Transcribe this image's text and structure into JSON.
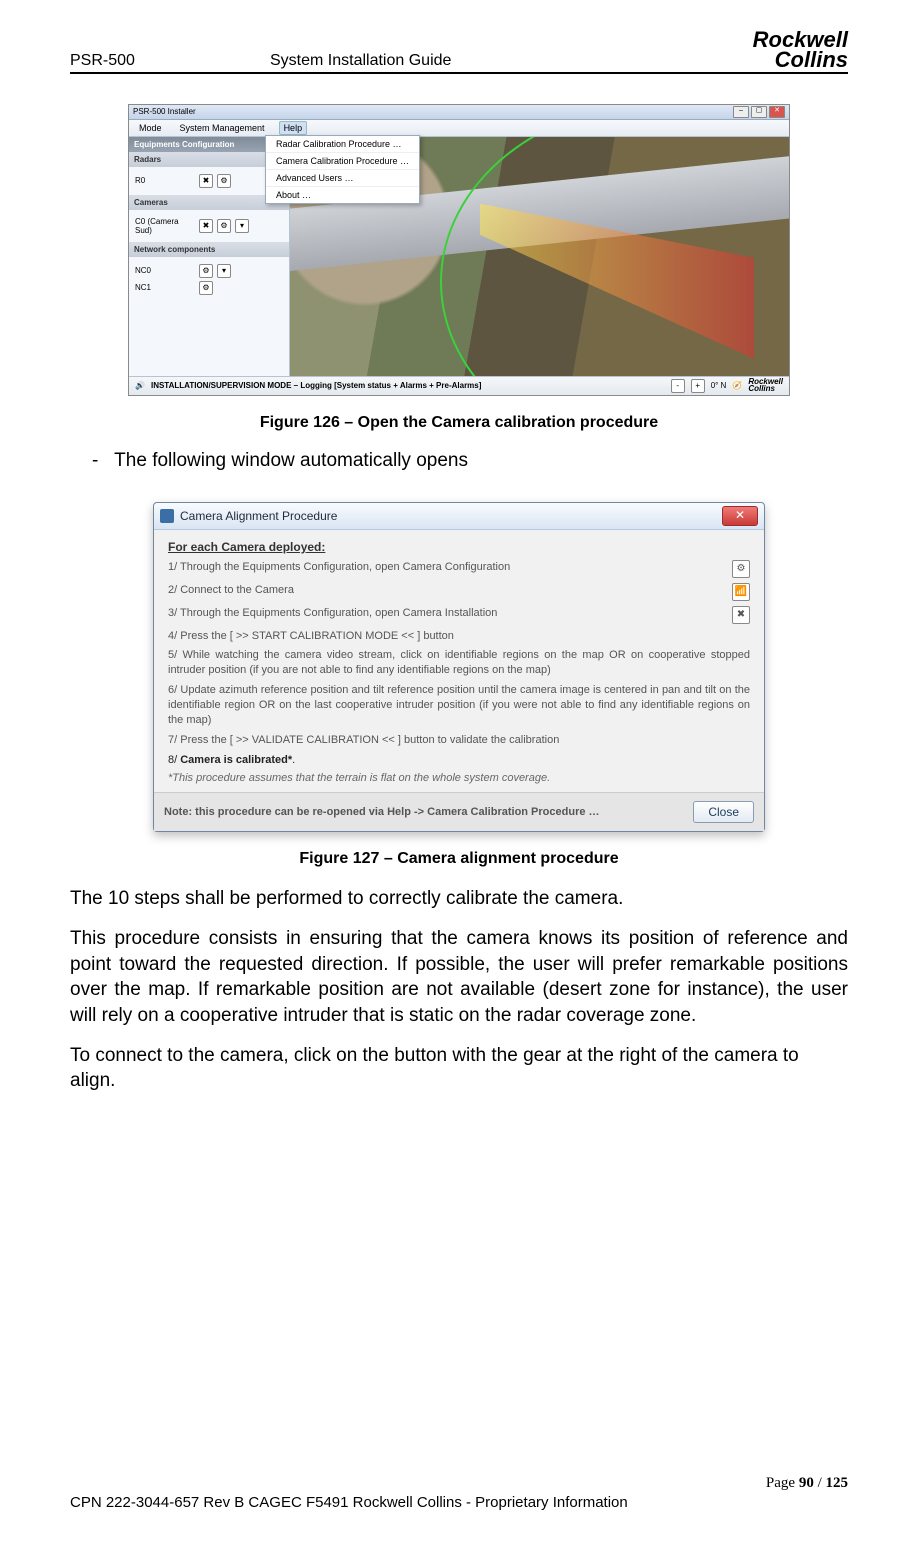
{
  "header": {
    "left": "PSR-500",
    "mid": "System Installation Guide",
    "logo_top": "Rockwell",
    "logo_bot": "Collins"
  },
  "fig126": {
    "caption": "Figure 126 – Open the Camera calibration procedure",
    "win_title": "PSR-500 Installer",
    "menu": {
      "mode": "Mode",
      "sys": "System Management",
      "help": "Help"
    },
    "dropdown": [
      "Radar Calibration Procedure …",
      "Camera Calibration Procedure …",
      "Advanced Users …",
      "About …"
    ],
    "side": {
      "equip": "Equipments Configuration",
      "radars": "Radars",
      "r0": "R0",
      "cameras": "Cameras",
      "c0": "C0 (Camera Sud)",
      "net": "Network components",
      "nc0": "NC0",
      "nc1": "NC1"
    },
    "status": {
      "left": "INSTALLATION/SUPERVISION MODE – Logging [System status + Alarms + Pre-Alarms]",
      "deg": "0° N"
    }
  },
  "bullet": "The following window automatically opens",
  "fig127": {
    "caption": "Figure 127 – Camera alignment procedure",
    "title": "Camera Alignment Procedure",
    "heading": "For each Camera deployed:",
    "steps": [
      "1/ Through the Equipments Configuration, open Camera Configuration",
      "2/ Connect to the Camera",
      "3/ Through the Equipments Configuration, open Camera Installation",
      "4/ Press the [ >> START CALIBRATION MODE << ] button",
      "5/ While watching the camera video stream, click on identifiable regions on the map OR on cooperative stopped intruder position (if you are not able to find any identifiable regions on the map)",
      "6/ Update azimuth reference position and tilt reference position until the camera image is centered in pan and tilt on the identifiable region OR on the last cooperative intruder position (if you were not able to find any identifiable regions on the map)",
      "7/ Press the [ >> VALIDATE CALIBRATION << ] button to validate the calibration"
    ],
    "step8_a": "8/ ",
    "step8_b": "Camera is calibrated*",
    "step8_c": ".",
    "asterisk": "*This procedure assumes that the terrain is flat on the whole system coverage.",
    "footer_note": "Note: this procedure can be re-opened via Help -> Camera Calibration Procedure …",
    "close": "Close"
  },
  "para1": "The 10 steps shall be performed to correctly calibrate the camera.",
  "para2": "This procedure consists in ensuring that the camera knows its position of reference and point toward the requested direction. If possible, the user will prefer remarkable positions over the map. If remarkable position are not available (desert zone for instance), the user will rely on a cooperative intruder that is static on the radar coverage zone.",
  "para3": "To connect to the camera, click on the button with the gear at the right of the camera to align.",
  "footer": {
    "page_a": "Page ",
    "page_b": "90",
    "page_c": " / ",
    "page_d": "125",
    "prop": "CPN 222-3044-657 Rev B CAGEC F5491 Rockwell Collins - Proprietary Information"
  }
}
